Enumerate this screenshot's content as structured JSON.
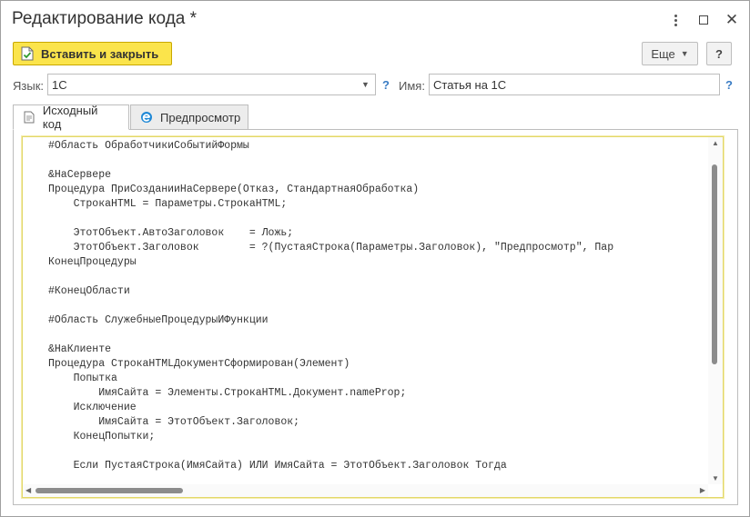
{
  "window": {
    "title": "Редактирование кода *"
  },
  "toolbar": {
    "save_close_label": "Вставить и закрыть",
    "more_label": "Еще",
    "help_label": "?"
  },
  "form": {
    "language_label": "Язык:",
    "language_value": "1С",
    "name_label": "Имя:",
    "name_value": "Статья на 1С",
    "help_mark": "?"
  },
  "tabs": [
    {
      "label": "Исходный код",
      "active": true,
      "icon": "document-icon"
    },
    {
      "label": "Предпросмотр",
      "active": false,
      "icon": "browser-e-icon"
    }
  ],
  "code": {
    "lines": [
      "#Область ОбработчикиСобытийФормы",
      "",
      "&НаСервере",
      "Процедура ПриСозданииНаСервере(Отказ, СтандартнаяОбработка)",
      "    СтрокаHTML = Параметры.СтрокаHTML;",
      "",
      "    ЭтотОбъект.АвтоЗаголовок    = Ложь;",
      "    ЭтотОбъект.Заголовок        = ?(ПустаяСтрока(Параметры.Заголовок), \"Предпросмотр\", Пар",
      "КонецПроцедуры",
      "",
      "#КонецОбласти",
      "",
      "#Область СлужебныеПроцедурыИФункции",
      "",
      "&НаКлиенте",
      "Процедура СтрокаHTMLДокументСформирован(Элемент)",
      "    Попытка",
      "        ИмяСайта = Элементы.СтрокаHTML.Документ.nameProp;",
      "    Исключение",
      "        ИмяСайта = ЭтотОбъект.Заголовок;",
      "    КонецПопытки;",
      "",
      "    Если ПустаяСтрока(ИмяСайта) ИЛИ ИмяСайта = ЭтотОбъект.Заголовок Тогда"
    ]
  },
  "colors": {
    "primary_button": "#fbe44b",
    "link_help": "#3a7cc4",
    "editor_border": "#e2d86a"
  }
}
